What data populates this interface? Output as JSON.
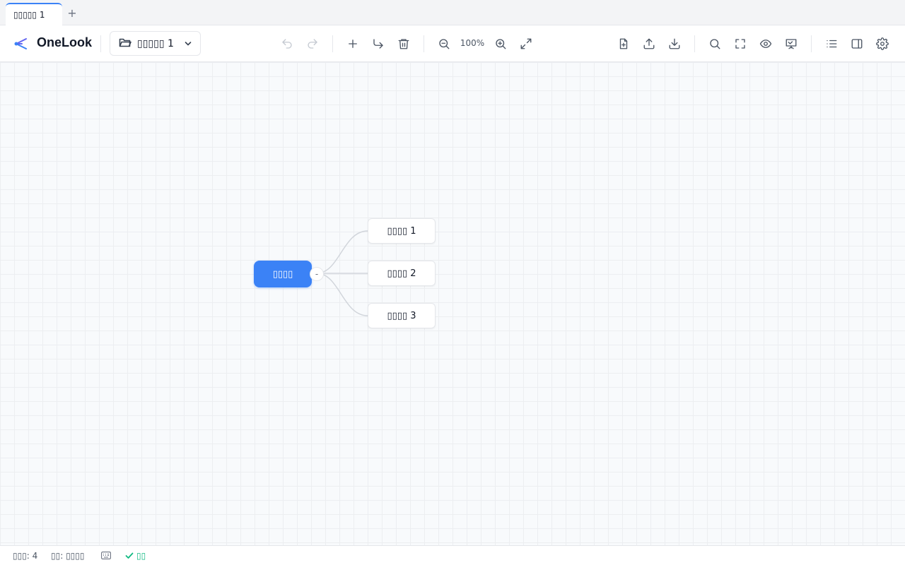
{
  "tabs": [
    {
      "label": "▯▯▯▯▯ 1",
      "active": true
    }
  ],
  "tab_add_label": "+",
  "app": {
    "name": "OneLook",
    "logo_icon": "mindmap-logo-icon",
    "accent": "#3b82f6"
  },
  "file_selector": {
    "label": "▯▯▯▯▯ 1",
    "icon": "folder-open-icon"
  },
  "toolbar": {
    "zoom_level": "100%",
    "buttons": [
      {
        "name": "undo-icon",
        "disabled": true
      },
      {
        "name": "redo-icon",
        "disabled": true
      },
      {
        "name": "add-node-icon"
      },
      {
        "name": "add-child-icon"
      },
      {
        "name": "delete-icon"
      },
      {
        "name": "zoom-out-icon"
      },
      {
        "name": "zoom-in-icon"
      },
      {
        "name": "fit-view-icon"
      },
      {
        "name": "new-file-icon"
      },
      {
        "name": "upload-icon"
      },
      {
        "name": "download-icon"
      },
      {
        "name": "search-icon"
      },
      {
        "name": "fullscreen-icon"
      },
      {
        "name": "preview-icon"
      },
      {
        "name": "presentation-icon"
      },
      {
        "name": "outline-icon"
      },
      {
        "name": "sidebar-icon"
      },
      {
        "name": "settings-icon"
      }
    ]
  },
  "mindmap": {
    "root": {
      "label": "▯▯▯▯",
      "collapse_symbol": "-"
    },
    "children": [
      {
        "label": "▯▯▯▯ 1"
      },
      {
        "label": "▯▯▯▯ 2"
      },
      {
        "label": "▯▯▯▯ 3"
      }
    ]
  },
  "status": {
    "node_count": "▯▯▯: 4",
    "layout": "▯▯: ▯▯▯▯",
    "keyboard_icon": "keyboard-icon",
    "saved": "▯▯",
    "saved_color": "#10b981"
  }
}
